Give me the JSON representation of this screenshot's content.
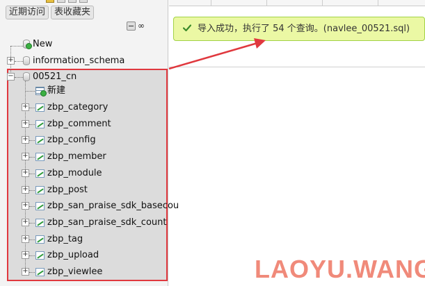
{
  "nav": {
    "tabs": [
      "近期访问",
      "表收藏夹"
    ],
    "link_glyph": "∞"
  },
  "tree": {
    "new_label": "New",
    "databases": [
      {
        "name": "information_schema"
      },
      {
        "name": "00521_cn"
      }
    ],
    "db_new_label": "新建",
    "tables": [
      "zbp_category",
      "zbp_comment",
      "zbp_config",
      "zbp_member",
      "zbp_module",
      "zbp_post",
      "zbp_san_praise_sdk_basecou",
      "zbp_san_praise_sdk_count",
      "zbp_tag",
      "zbp_upload",
      "zbp_viewlee"
    ]
  },
  "notice": {
    "text": "导入成功，执行了 54 个查询。(navlee_00521.sql)"
  },
  "watermark": "LAOYU.WANG",
  "colors": {
    "highlight": "#e0383e",
    "success_bg": "#ebf8a4",
    "success_border": "#a2d246",
    "check": "#3a8a2a"
  }
}
